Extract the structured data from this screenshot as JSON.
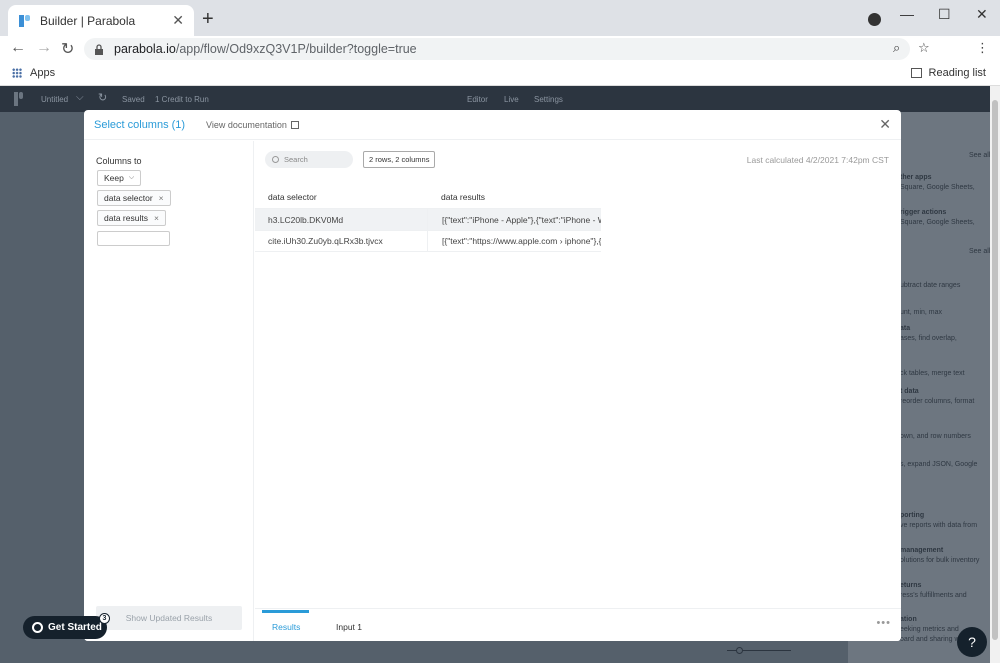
{
  "browser": {
    "tab_title": "Builder | Parabola",
    "tab_close": "✕",
    "new_tab": "+",
    "url_host": "parabola.io",
    "url_path": "/app/flow/Od9xzQ3V1P/builder?toggle=true",
    "bookmarks": {
      "apps_label": "Apps",
      "reading_list_label": "Reading list"
    },
    "window_controls": {
      "minimize": "—",
      "maximize": "☐",
      "close": "✕"
    },
    "nav": {
      "back": "←",
      "forward": "→",
      "reload": "↻",
      "zoom": "⌕",
      "star": "☆",
      "menu": "⋮"
    }
  },
  "app_header": {
    "flow_name": "Untitled",
    "saved": "Saved",
    "credits": "1 Credit to Run",
    "tabs": [
      "Editor",
      "Live",
      "Settings"
    ]
  },
  "background_panel": {
    "see_all_1": "See all",
    "see_all_2": "See all",
    "items": [
      {
        "title": "ther apps",
        "desc": "Square, Google Sheets,"
      },
      {
        "title": "rigger actions",
        "desc": "Square, Google Sheets,"
      },
      {
        "title": "",
        "desc": "ubtract date ranges"
      },
      {
        "title": "",
        "desc": "unt, min, max"
      },
      {
        "title": "ata",
        "desc": "ases, find overlap,"
      },
      {
        "title": "",
        "desc": "ck tables, merge text"
      },
      {
        "title": "t data",
        "desc": "reorder columns, format"
      },
      {
        "title": "",
        "desc": "own, and row numbers"
      },
      {
        "title": "",
        "desc": "s, expand JSON, Google"
      },
      {
        "title": "porting",
        "desc": "ve reports with data from"
      },
      {
        "title": "management",
        "desc": "olutions for bulk inventory"
      },
      {
        "title": "eturns",
        "desc": "ress's fulfillments and"
      },
      {
        "title": "ation",
        "desc": "eeking metrics and"
      },
      {
        "title": "",
        "desc": "oard and sharing workflows"
      }
    ]
  },
  "modal": {
    "title": "Select columns (1)",
    "doc_link": "View documentation",
    "close": "✕",
    "left": {
      "columns_to_label": "Columns to",
      "mode": "Keep",
      "tags": [
        "data selector",
        "data results"
      ],
      "tag_remove": "×",
      "show_updated": "Show Updated Results"
    },
    "right": {
      "search_placeholder": "Search",
      "rows_badge": "2 rows, 2 columns",
      "last_calculated": "Last calculated 4/2/2021 7:42pm CST",
      "table": {
        "columns": [
          "data selector",
          "data results"
        ],
        "rows": [
          [
            "h3.LC20lb.DKV0Md",
            "[{\"text\":\"iPhone - Apple\"},{\"text\":\"iPhone - Wi"
          ],
          [
            "cite.iUh30.Zu0yb.qLRx3b.tjvcx",
            "[{\"text\":\"https://www.apple.com › iphone\"},{\"t"
          ]
        ]
      }
    },
    "bottom_tabs": [
      "Results",
      "Input 1"
    ],
    "more": "•••"
  },
  "get_started": {
    "label": "Get Started",
    "badge": "3"
  },
  "help": {
    "label": "?"
  }
}
